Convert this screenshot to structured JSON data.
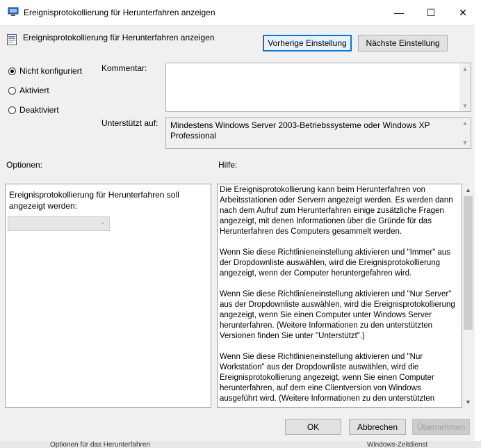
{
  "window": {
    "title": "Ereignisprotokollierung für Herunterfahren anzeigen",
    "minimize": "—",
    "maximize": "☐",
    "close": "✕"
  },
  "header": {
    "policy_name": "Ereignisprotokollierung für Herunterfahren anzeigen",
    "prev_button": "Vorherige Einstellung",
    "next_button": "Nächste Einstellung"
  },
  "state": {
    "options": [
      {
        "label": "Nicht konfiguriert",
        "selected": true
      },
      {
        "label": "Aktiviert",
        "selected": false
      },
      {
        "label": "Deaktiviert",
        "selected": false
      }
    ]
  },
  "comment": {
    "label": "Kommentar:",
    "value": ""
  },
  "supported": {
    "label": "Unterstützt auf:",
    "value": "Mindestens Windows Server 2003-Betriebssysteme oder Windows XP Professional"
  },
  "options_section": {
    "label": "Optionen:",
    "text": "Ereignisprotokollierung für Herunterfahren soll angezeigt werden:",
    "dropdown_value": ""
  },
  "help_section": {
    "label": "Hilfe:",
    "paragraphs": [
      "Die Ereignisprotokollierung kann beim Herunterfahren von Arbeitsstationen oder Servern angezeigt werden.  Es werden dann nach dem Aufruf zum Herunterfahren einige zusätzliche Fragen angezeigt, mit denen Informationen über die Gründe für das Herunterfahren des Computers gesammelt werden.",
      "Wenn Sie diese Richtlinieneinstellung aktivieren und \"Immer\" aus der Dropdownliste auswählen, wird die Ereignisprotokollierung angezeigt, wenn der Computer heruntergefahren wird.",
      "Wenn Sie diese Richtlinieneinstellung aktivieren und \"Nur Server\" aus der Dropdownliste auswählen, wird die Ereignisprotokollierung angezeigt, wenn Sie einen Computer unter Windows Server herunterfahren. (Weitere Informationen zu den unterstützten Versionen finden Sie unter \"Unterstützt\".)",
      "Wenn Sie diese Richtlinieneinstellung aktivieren und \"Nur Workstation\" aus der Dropdownliste auswählen, wird die Ereignisprotokollierung angezeigt, wenn Sie einen Computer herunterfahren, auf dem eine Clientversion von Windows ausgeführt wird. (Weitere Informationen zu den unterstützten"
    ]
  },
  "footer": {
    "ok": "OK",
    "cancel": "Abbrechen",
    "apply": "Übernehmen"
  },
  "background": {
    "left_text": "Optionen für das Herunterfahren",
    "right_text": "Windows-Zeitdienst"
  }
}
